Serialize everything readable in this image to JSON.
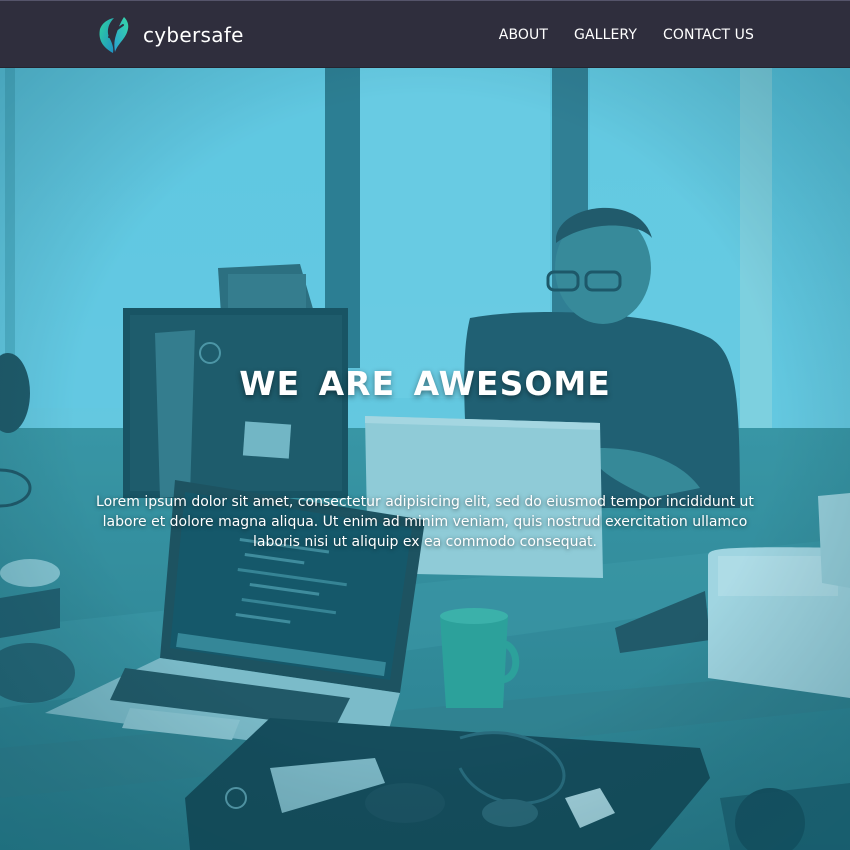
{
  "header": {
    "brand_name": "cybersafe",
    "logo_icon": "leaf-shield-logo-icon",
    "nav": [
      {
        "label": "ABOUT"
      },
      {
        "label": "GALLERY"
      },
      {
        "label": "CONTACT US"
      }
    ],
    "background_color": "#2f2e3d"
  },
  "hero": {
    "title": "WE ARE AWESOME",
    "text": "Lorem ipsum dolor sit amet, consectetur adipisicing elit, sed do eiusmod tempor incididunt ut labore et dolore magna aliqua. Ut enim ad minim veniam, quis nostrud exercitation ullamco laboris nisi ut aliquip ex ea commodo consequat.",
    "background_image": "office-workspace-photo",
    "overlay_color": "#2aa9c6"
  }
}
